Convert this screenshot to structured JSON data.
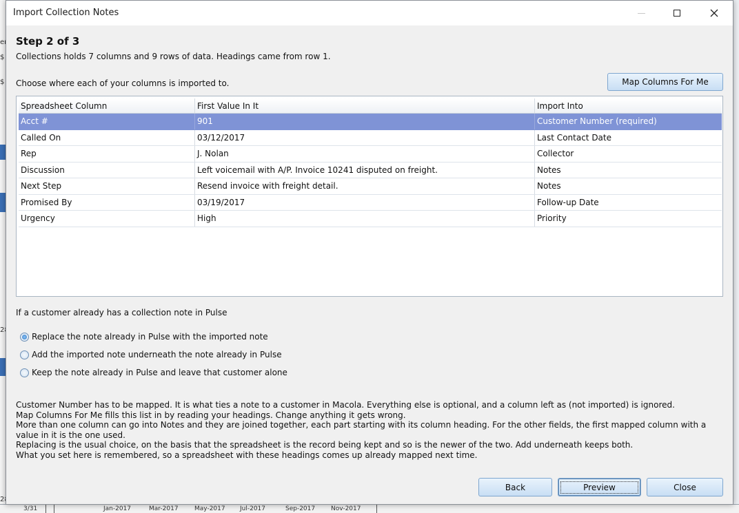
{
  "window": {
    "title": "Import Collection Notes"
  },
  "step": {
    "title": "Step 2 of 3",
    "summary": "Collections holds 7 columns and 9 rows of data.  Headings came from row 1.",
    "instruction": "Choose where each of your columns is imported to."
  },
  "buttons": {
    "map": "Map Columns For Me",
    "back": "Back",
    "preview": "Preview",
    "close": "Close"
  },
  "table": {
    "headers": [
      "Spreadsheet Column",
      "First Value In It",
      "Import Into"
    ],
    "rows": [
      [
        "Acct #",
        "901",
        "Customer Number (required)"
      ],
      [
        "Called On",
        "03/12/2017",
        "Last Contact Date"
      ],
      [
        "Rep",
        "J. Nolan",
        "Collector"
      ],
      [
        "Discussion",
        "Left voicemail with A/P. Invoice 10241 disputed on freight.",
        "Notes"
      ],
      [
        "Next Step",
        "Resend invoice with freight detail.",
        "Notes"
      ],
      [
        "Promised By",
        "03/19/2017",
        "Follow-up Date"
      ],
      [
        "Urgency",
        "High",
        "Priority"
      ]
    ]
  },
  "existing": {
    "question": "If a customer already has a collection note in Pulse",
    "options": [
      "Replace the note already in Pulse with the imported note",
      "Add the imported note underneath the note already in Pulse",
      "Keep the note already in Pulse and leave that customer alone"
    ]
  },
  "help": {
    "lines": [
      "Customer Number has to be mapped.  It is what ties a note to a customer in Macola.  Everything else is optional, and a column left as (not imported) is ignored.",
      "Map Columns For Me fills this list in by reading your headings.  Change anything it gets wrong.",
      "More than one column can go into Notes and they are joined together, each part starting with its column heading.  For the other fields, the first mapped column with a value in it is the one used.",
      "Replacing is the usual choice, on the basis that the spreadsheet is the record being kept and so is the newer of the two.  Add underneath keeps both.",
      "What you set here is remembered, so a spreadsheet with these headings comes up already mapped next time."
    ]
  },
  "background": {
    "left_marks": [
      "er",
      "$",
      "$",
      "28",
      "28"
    ],
    "axis_labels": [
      "3/31",
      "Jan-2017",
      "Mar-2017",
      "May-2017",
      "Jul-2017",
      "Sep-2017",
      "Nov-2017"
    ]
  }
}
